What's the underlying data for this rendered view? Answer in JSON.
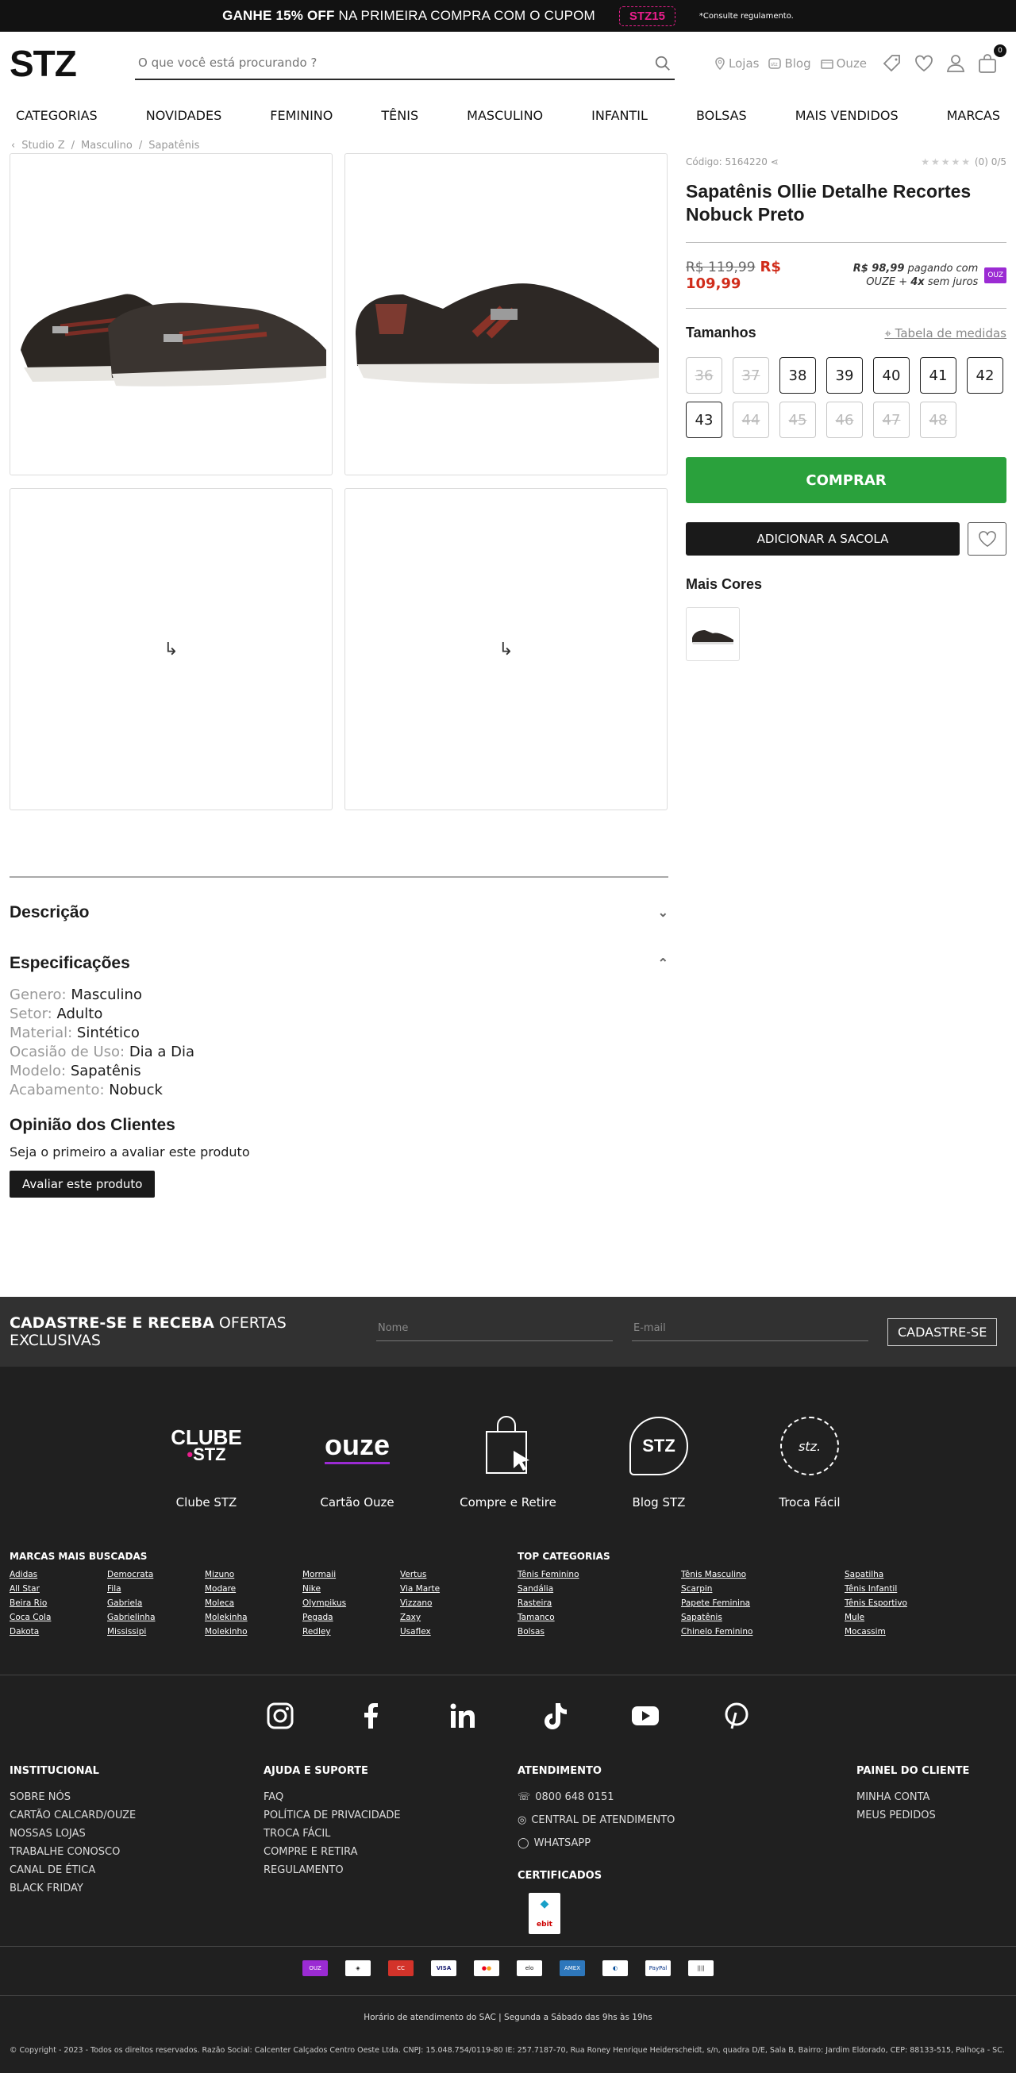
{
  "topbar": {
    "promo_bold": "GANHE 15% OFF",
    "promo_rest": " NA PRIMEIRA COMPRA COM O CUPOM",
    "coupon": "STZ15",
    "regulation": "*Consulte regulamento."
  },
  "header": {
    "logo": "STZ",
    "search_placeholder": "O que você está procurando ?",
    "links": [
      "Lojas",
      "Blog",
      "Ouze"
    ],
    "cart_count": "0"
  },
  "nav": [
    "CATEGORIAS",
    "NOVIDADES",
    "FEMININO",
    "TÊNIS",
    "MASCULINO",
    "INFANTIL",
    "BOLSAS",
    "MAIS VENDIDOS",
    "MARCAS"
  ],
  "breadcrumb": [
    "Studio Z",
    "Masculino",
    "Sapatênis"
  ],
  "product": {
    "code": "Código: 5164220",
    "rating": "(0) 0/5",
    "title": "Sapatênis Ollie Detalhe Recortes Nobuck Preto",
    "old_price": "R$ 119,99",
    "price": "R$ 109,99",
    "ouze_price": "R$ 98,99",
    "ouze_text1": " pagando com",
    "ouze_text2": "OUZE + ",
    "ouze_installments": "4x",
    "ouze_text3": " sem juros",
    "ouze_badge": "OUZ",
    "sizes_title": "Tamanhos",
    "size_chart": "Tabela de medidas",
    "sizes": [
      {
        "label": "36",
        "available": false
      },
      {
        "label": "37",
        "available": false
      },
      {
        "label": "38",
        "available": true
      },
      {
        "label": "39",
        "available": true
      },
      {
        "label": "40",
        "available": true
      },
      {
        "label": "41",
        "available": true
      },
      {
        "label": "42",
        "available": true
      },
      {
        "label": "43",
        "available": true
      },
      {
        "label": "44",
        "available": false
      },
      {
        "label": "45",
        "available": false
      },
      {
        "label": "46",
        "available": false
      },
      {
        "label": "47",
        "available": false
      },
      {
        "label": "48",
        "available": false
      }
    ],
    "buy": "COMPRAR",
    "add_to_bag": "ADICIONAR A SACOLA",
    "more_colors": "Mais Cores"
  },
  "description": {
    "title": "Descrição"
  },
  "specs": {
    "title": "Especificações",
    "items": [
      {
        "k": "Genero: ",
        "v": "Masculino"
      },
      {
        "k": "Setor: ",
        "v": "Adulto"
      },
      {
        "k": "Material: ",
        "v": "Sintético"
      },
      {
        "k": "Ocasião de Uso: ",
        "v": "Dia a Dia"
      },
      {
        "k": "Modelo: ",
        "v": "Sapatênis"
      },
      {
        "k": "Acabamento: ",
        "v": "Nobuck"
      }
    ]
  },
  "reviews": {
    "title": "Opinião dos Clientes",
    "empty": "Seja o primeiro a avaliar este produto",
    "button": "Avaliar este produto"
  },
  "newsletter": {
    "bold": "CADASTRE-SE E RECEBA",
    "rest": " OFERTAS EXCLUSIVAS",
    "name_ph": "Nome",
    "email_ph": "E-mail",
    "button": "CADASTRE-SE"
  },
  "services": [
    {
      "label": "Clube STZ",
      "logo": "CLUBE",
      "logo2": "STZ"
    },
    {
      "label": "Cartão Ouze",
      "logo": "ouze"
    },
    {
      "label": "Compre e Retire"
    },
    {
      "label": "Blog STZ",
      "logo": "STZ"
    },
    {
      "label": "Troca Fácil",
      "logo": "stz."
    }
  ],
  "brands": {
    "title": "MARCAS MAIS BUSCADAS",
    "items": [
      "Adidas",
      "Democrata",
      "Mizuno",
      "Mormaii",
      "Vertus",
      "All Star",
      "Fila",
      "Modare",
      "Nike",
      "Via Marte",
      "Beira Rio",
      "Gabriela",
      "Moleca",
      "Olympikus",
      "Vizzano",
      "Coca Cola",
      "Gabrielinha",
      "Molekinha",
      "Pegada",
      "Zaxy",
      "Dakota",
      "Mississipi",
      "Molekinho",
      "Redley",
      "Usaflex"
    ]
  },
  "top_categories": {
    "title": "TOP CATEGORIAS",
    "items": [
      "Tênis Feminino",
      "Tênis Masculino",
      "Sapatilha",
      "Sandália",
      "Scarpin",
      "Tênis Infantil",
      "Rasteira",
      "Papete Feminina",
      "Tênis Esportivo",
      "Tamanco",
      "Sapatênis",
      "Mule",
      "Bolsas",
      "Chinelo Feminino",
      "Mocassim"
    ]
  },
  "footer_links": {
    "institucional": {
      "title": "INSTITUCIONAL",
      "items": [
        "SOBRE NÓS",
        "CARTÃO CALCARD/OUZE",
        "NOSSAS LOJAS",
        "TRABALHE CONOSCO",
        "CANAL DE ÉTICA",
        "BLACK FRIDAY"
      ]
    },
    "ajuda": {
      "title": "AJUDA E SUPORTE",
      "items": [
        "FAQ",
        "POLÍTICA DE PRIVACIDADE",
        "TROCA FÁCIL",
        "COMPRE E RETIRA",
        "REGULAMENTO"
      ]
    },
    "atendimento": {
      "title": "ATENDIMENTO",
      "items": [
        "0800 648 0151",
        "CENTRAL DE ATENDIMENTO",
        "WHATSAPP"
      ],
      "cert_title": "CERTIFICADOS"
    },
    "painel": {
      "title": "PAINEL DO CLIENTE",
      "items": [
        "MINHA CONTA",
        "MEUS PEDIDOS"
      ]
    }
  },
  "hours": "Horário de atendimento do SAC | Segunda a Sábado das 9hs às 19hs",
  "copyright": "© Copyright - 2023 - Todos os direitos reservados. Razão Social: Calcenter Calçados Centro Oeste Ltda. CNPJ: 15.048.754/0119-80 IE: 257.7187-70, Rua Roney Henrique Heiderscheidt, s/n, quadra D/E, Sala B, Bairro: Jardim Eldorado, CEP: 88133-515, Palhoça - SC."
}
